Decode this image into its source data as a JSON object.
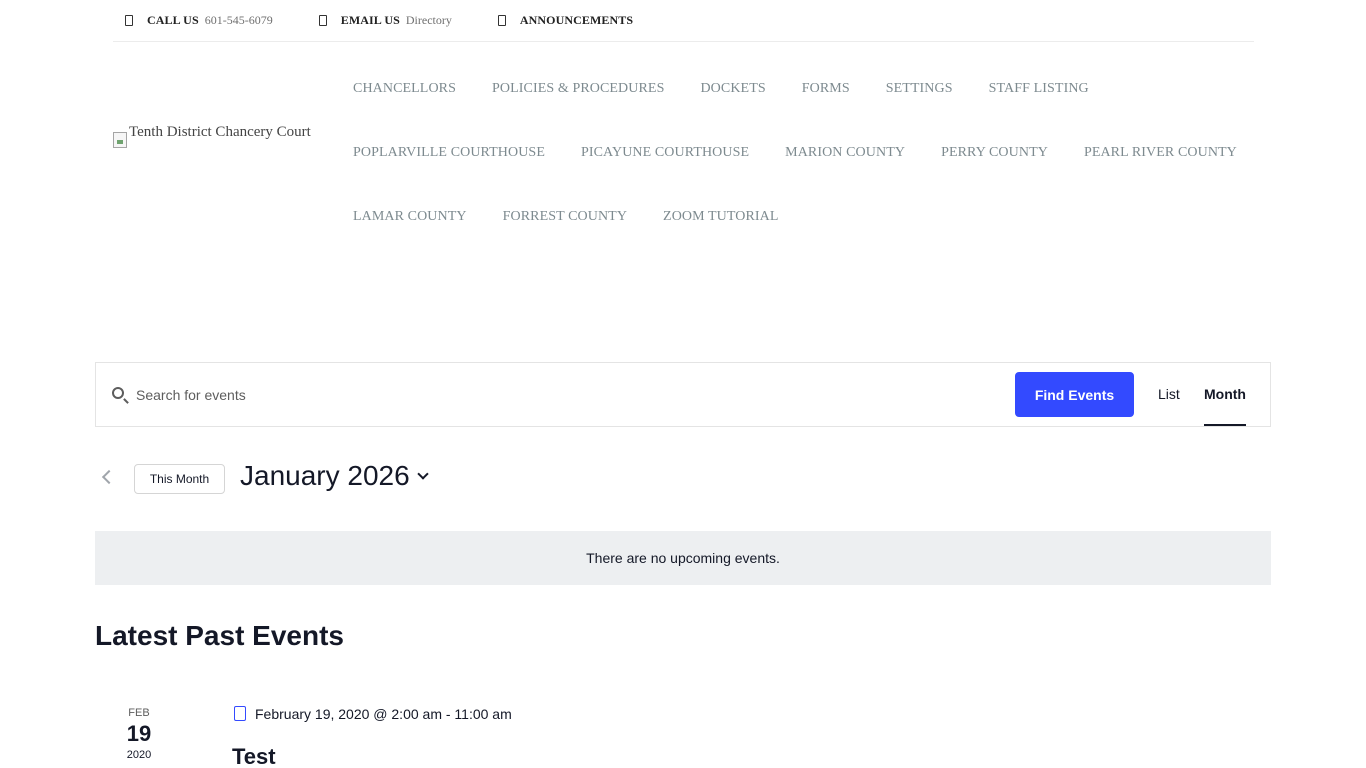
{
  "topbar": {
    "call_label": "CALL US",
    "call_value": "601-545-6079",
    "email_label": "EMAIL US",
    "email_value": "Directory",
    "announcements_label": "ANNOUNCEMENTS"
  },
  "logo": {
    "alt_text": "Tenth District Chancery Court"
  },
  "nav": {
    "rows": [
      [
        "CHANCELLORS",
        "POLICIES & PROCEDURES",
        "DOCKETS",
        "FORMS",
        "SETTINGS",
        "STAFF LISTING"
      ],
      [
        "POPLARVILLE COURTHOUSE",
        "PICAYUNE COURTHOUSE",
        "MARION COUNTY",
        "PERRY COUNTY",
        "PEARL RIVER COUNTY"
      ],
      [
        "LAMAR COUNTY",
        "FORREST COUNTY",
        "ZOOM TUTORIAL"
      ]
    ]
  },
  "events_bar": {
    "search_placeholder": "Search for events",
    "find_button": "Find Events",
    "view_list": "List",
    "view_month": "Month"
  },
  "date_nav": {
    "this_month_button": "This Month",
    "current_month": "January 2026"
  },
  "notice": {
    "message": "There are no upcoming events."
  },
  "past_events": {
    "heading": "Latest Past Events",
    "events": [
      {
        "month": "FEB",
        "day": "19",
        "year": "2020",
        "datetime": "February 19, 2020 @ 2:00 am - 11:00 am",
        "title": "Test"
      }
    ]
  },
  "colors": {
    "accent": "#334aff",
    "nav_text": "#7d8a8f",
    "notice_bg": "#edeff1"
  }
}
